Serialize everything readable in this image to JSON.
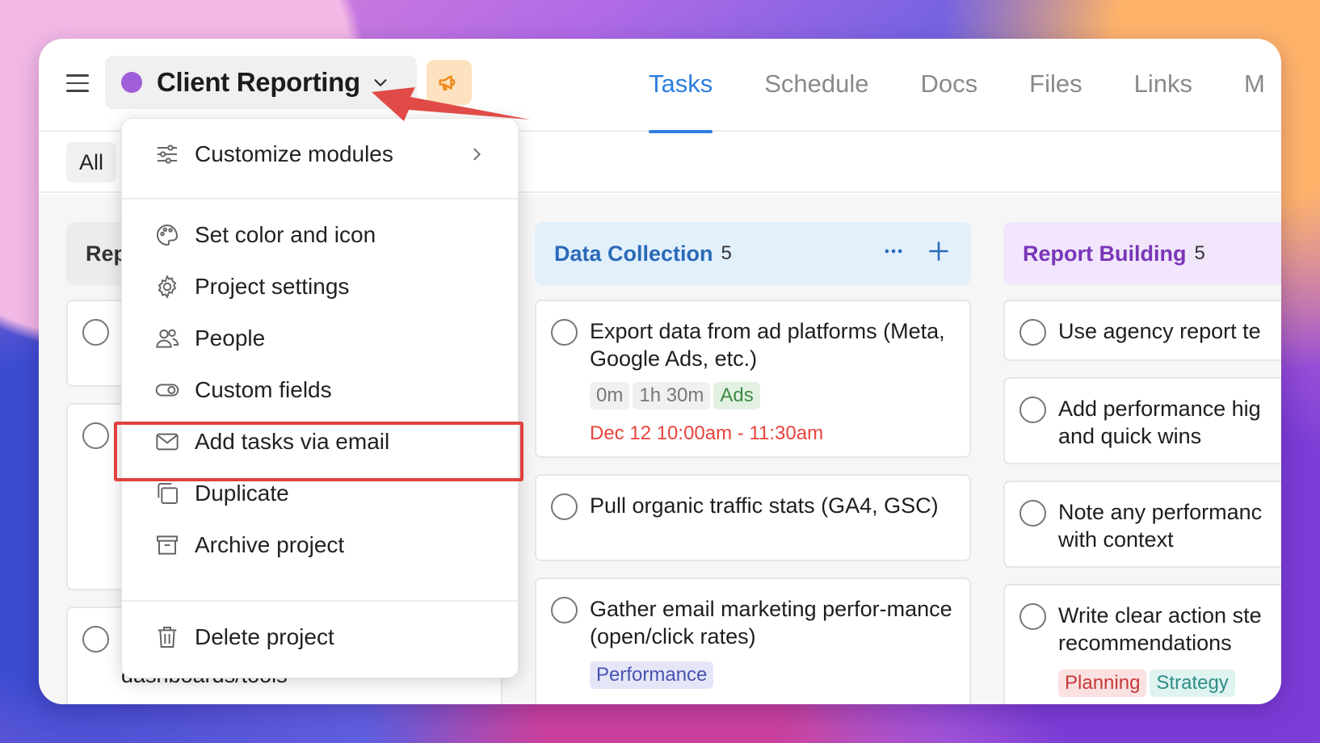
{
  "project": {
    "name": "Client Reporting",
    "color": "#a05ed9"
  },
  "tabs": [
    {
      "label": "Tasks",
      "active": true
    },
    {
      "label": "Schedule"
    },
    {
      "label": "Docs"
    },
    {
      "label": "Files"
    },
    {
      "label": "Links"
    },
    {
      "label": "M"
    }
  ],
  "filter": {
    "all_label": "All"
  },
  "menu": {
    "items": [
      {
        "label": "Customize modules",
        "icon": "sliders-icon"
      },
      {
        "label": "Set color and icon",
        "icon": "palette-icon"
      },
      {
        "label": "Project settings",
        "icon": "gear-icon"
      },
      {
        "label": "People",
        "icon": "people-icon"
      },
      {
        "label": "Custom fields",
        "icon": "toggle-icon"
      },
      {
        "label": "Add tasks via email",
        "icon": "mail-icon",
        "highlighted": true
      },
      {
        "label": "Duplicate",
        "icon": "duplicate-icon"
      },
      {
        "label": "Archive project",
        "icon": "archive-icon"
      },
      {
        "label": "Delete project",
        "icon": "trash-icon"
      }
    ]
  },
  "columns": {
    "left": {
      "title": "Rep",
      "partial_text": "dashboards/tools"
    },
    "data_collection": {
      "title": "Data Collection",
      "count": "5",
      "color": "#e2f0fc",
      "title_color": "#2a6ab8",
      "cards": [
        {
          "title": "Export data from ad platforms (Meta, Google Ads, etc.)",
          "time_tags": [
            "0m",
            "1h 30m"
          ],
          "tag": "Ads",
          "date": "Dec 12 10:00am - 11:30am"
        },
        {
          "title": "Pull organic traffic stats (GA4, GSC)"
        },
        {
          "title": "Gather email marketing perfor-mance (open/click rates)",
          "tag": "Performance"
        }
      ]
    },
    "report_building": {
      "title": "Report Building",
      "count": "5",
      "color": "#f1e6fb",
      "title_color": "#7a35b8",
      "cards": [
        {
          "title": "Use agency report te"
        },
        {
          "title": "Add performance hig and quick wins"
        },
        {
          "title": "Note any performanc with context"
        },
        {
          "title": "Write clear action ste recommendations",
          "tags": [
            "Planning",
            "Strategy"
          ]
        }
      ]
    }
  }
}
